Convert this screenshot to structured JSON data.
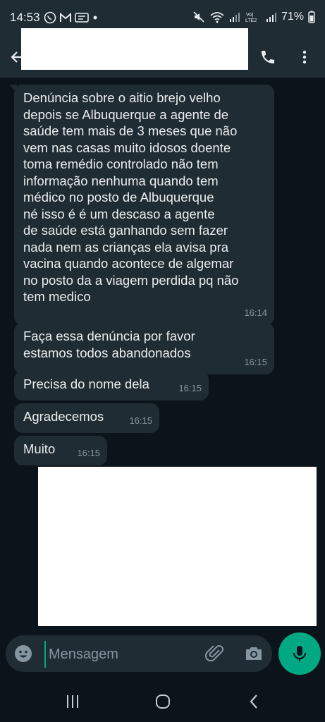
{
  "status_bar": {
    "time": "14:53",
    "battery_percent": "71%",
    "left_icons": [
      "whatsapp-icon",
      "gmail-icon",
      "message-icon",
      "dot-icon"
    ],
    "right_icons": [
      "mute-icon",
      "wifi-icon",
      "signal-icon",
      "volte-icon",
      "signal-icon",
      "battery-icon"
    ]
  },
  "header": {
    "contact_name": "",
    "actions": [
      "phone-icon",
      "more-vert-icon"
    ]
  },
  "messages": [
    {
      "text": "Denúncia sobre o aitio brejo velho\ndepois se Albuquerque a agente de\nsaúde tem mais de 3 meses que não\nvem nas casas muito idosos doente\ntoma remédio controlado não tem\ninformação  nenhuma quando tem\nmédico no posto de Albuquerque\nné isso é  é  um descaso a agente\nde saúde está ganhando sem fazer\nnada nem as crianças ela avisa pra\nvacina quando acontece de algemar\nno posto da a viagem perdida pq não\ntem medico",
      "time": "16:14"
    },
    {
      "text": "Faça essa denúncia por favor\nestamos todos abandonados",
      "time": "16:15"
    },
    {
      "text": "Precisa do nome dela",
      "time": "16:15"
    },
    {
      "text": "Agradecemos",
      "time": "16:15"
    },
    {
      "text": "Muito",
      "time": "16:15"
    }
  ],
  "input": {
    "placeholder": "Mensagem"
  },
  "colors": {
    "background": "#0b141a",
    "bubble_incoming": "#202c33",
    "accent": "#00a884",
    "text": "#e9edef",
    "timestamp": "#8696a0"
  }
}
